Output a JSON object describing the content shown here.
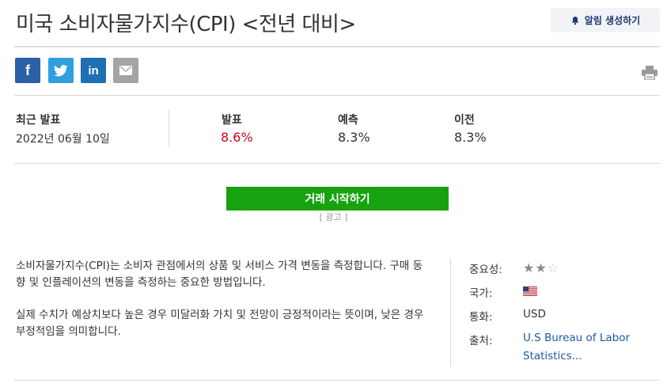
{
  "header": {
    "title": "미국 소비자물가지수(CPI) <전년 대비>",
    "alert_button": "알림 생성하기",
    "bell_icon": "bell-icon"
  },
  "share": {
    "facebook_glyph": "f",
    "linkedin_glyph": "in"
  },
  "stats": {
    "latest_label": "최근 발표",
    "latest_date": "2022년 06월 10일",
    "actual_label": "발표",
    "actual_value": "8.6%",
    "forecast_label": "예측",
    "forecast_value": "8.3%",
    "previous_label": "이전",
    "previous_value": "8.3%"
  },
  "trade": {
    "button_label": "거래 시작하기",
    "ad_label": "[ 광고 ]"
  },
  "description": {
    "paragraph1": "소비자물가지수(CPI)는 소비자 관점에서의 상품 및 서비스 가격 변동을 측정합니다. 구매 동향 및 인플레이션의 변동을 측정하는 중요한 방법입니다.",
    "paragraph2": "실제 수치가 예상치보다 높은 경우 미달러화 가치 및 전망이 긍정적이라는 뜻이며, 낮은 경우 부정적임을 의미합니다."
  },
  "meta": {
    "importance_label": "중요성:",
    "importance_stars": 2,
    "importance_max": 3,
    "country_label": "국가:",
    "country_flag": "us-flag-icon",
    "currency_label": "통화:",
    "currency_value": "USD",
    "source_label": "출처:",
    "source_value": "U.S Bureau of Labor Statistics..."
  },
  "colors": {
    "actual": "#d0021b",
    "trade_button": "#17a30f",
    "facebook": "#2b5fa6",
    "twitter": "#2f9fe0",
    "linkedin": "#1e6fb4",
    "mail": "#a4a4a4",
    "link": "#2256a7"
  }
}
